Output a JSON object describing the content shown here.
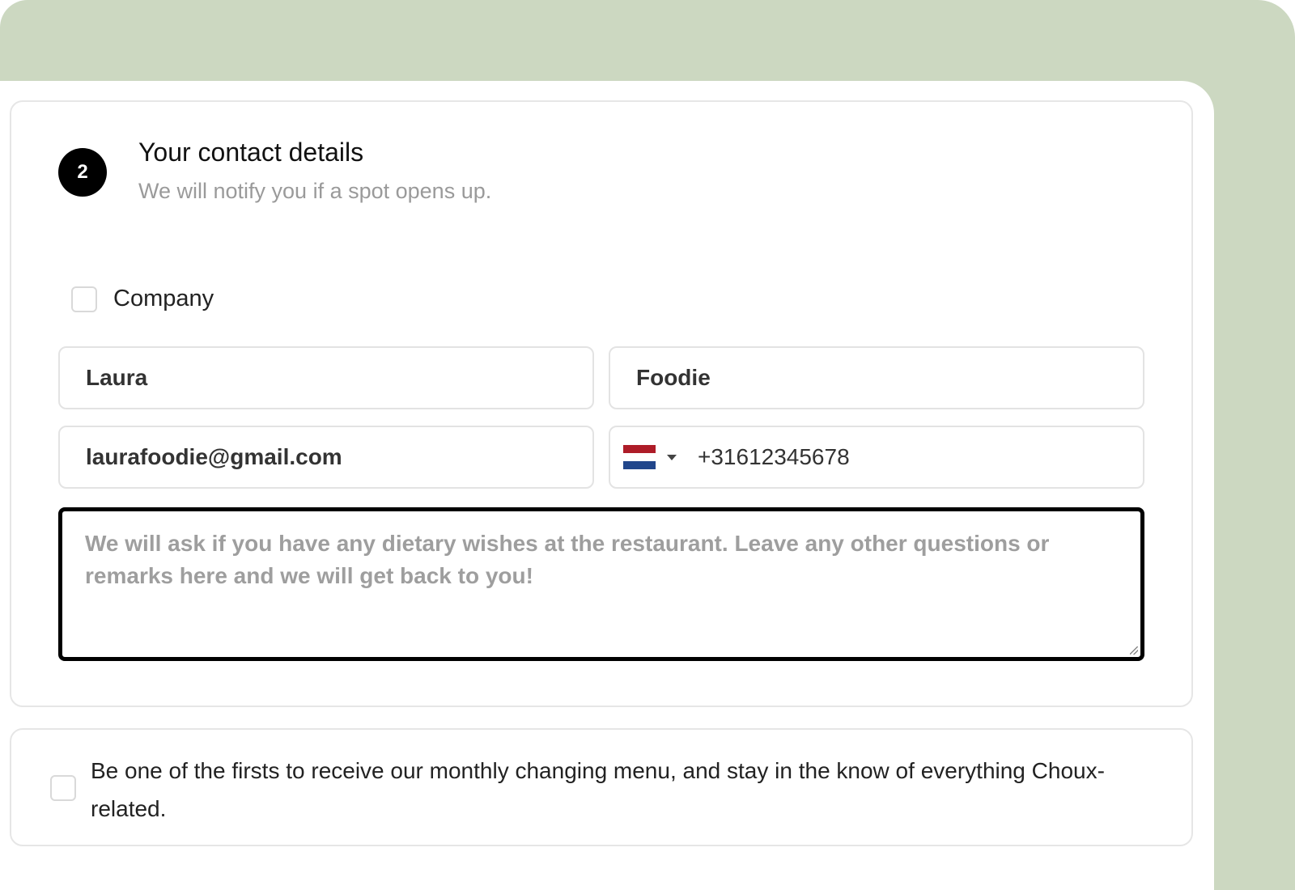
{
  "step": {
    "number": "2",
    "title": "Your contact details",
    "subtitle": "We will notify you if a spot opens up."
  },
  "company": {
    "label": "Company",
    "checked": false
  },
  "fields": {
    "first_name": "Laura",
    "last_name": "Foodie",
    "email": "laurafoodie@gmail.com",
    "phone": {
      "country_flag": "netherlands-flag",
      "value": "+31612345678"
    },
    "remarks_placeholder": "We will ask if you have any dietary wishes at the restaurant. Leave any other questions or remarks here and we will get back to you!"
  },
  "newsletter": {
    "label": "Be one of the firsts to receive our monthly changing menu, and stay in the know of everything Choux-related.",
    "checked": false
  },
  "colors": {
    "backdrop": "#ccd8c1",
    "badge": "#000000",
    "focus_border": "#000000"
  }
}
